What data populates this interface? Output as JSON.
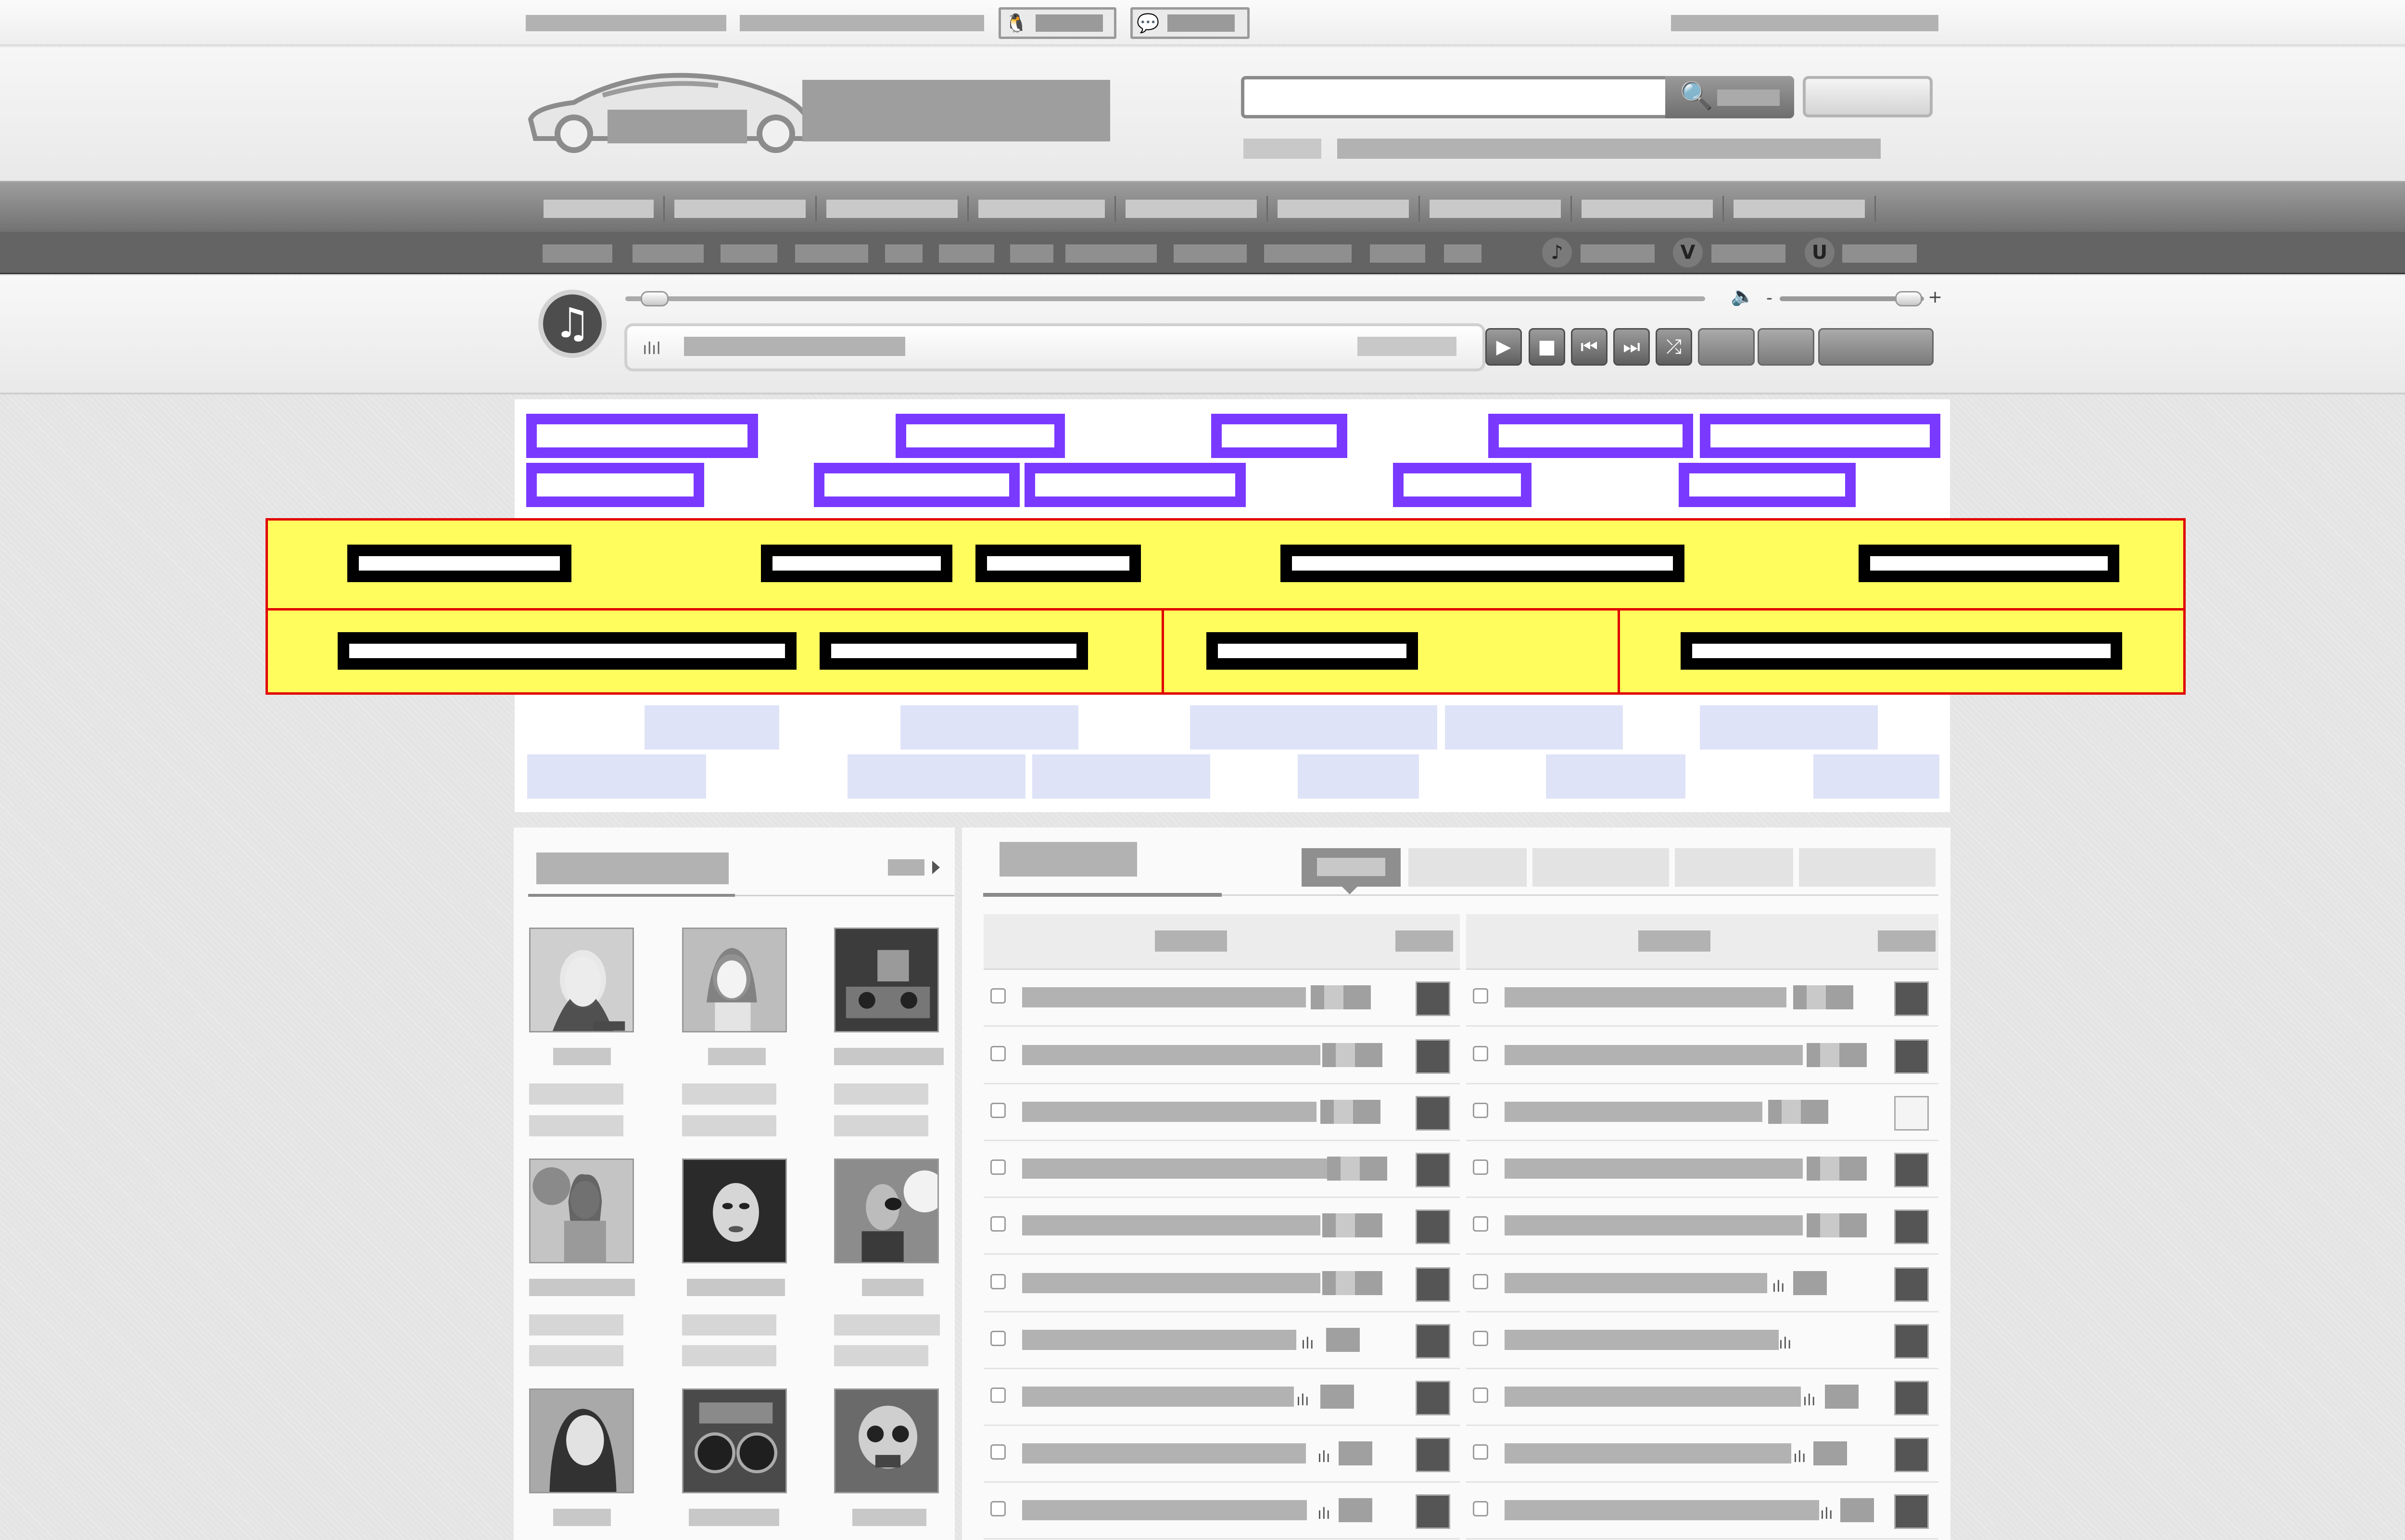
{
  "topbar": {
    "qq_icon": "qq-penguin-icon",
    "wechat_icon": "wechat-icon",
    "qq_glyph": "🐧",
    "wechat_glyph": "💬"
  },
  "search": {
    "placeholder": "",
    "icon": "magnifier-icon",
    "icon_glyph": "🔍"
  },
  "player": {
    "disc_icon": "music-note-icon",
    "disc_glyph": "♫",
    "volume_icon": "speaker-icon",
    "volume_glyph": "🔈",
    "volume_minus": "-",
    "volume_plus": "+",
    "equalizer_glyph": "ılıl",
    "play_glyph": "▶",
    "stop_glyph": "■",
    "prev_glyph": "⏮",
    "next_glyph": "⏭",
    "shuffle_glyph": "⤮"
  },
  "subnav_icons": {
    "music_glyph": "♪",
    "v_glyph": "V",
    "u_glyph": "U"
  },
  "colors": {
    "tag_highlight": "#7a39ff",
    "tag_band": "#fffc5e",
    "tag_band_border": "#e00000",
    "tag_light": "#dfe3f7"
  },
  "tracks": {
    "bars_glyph": "ılı"
  }
}
